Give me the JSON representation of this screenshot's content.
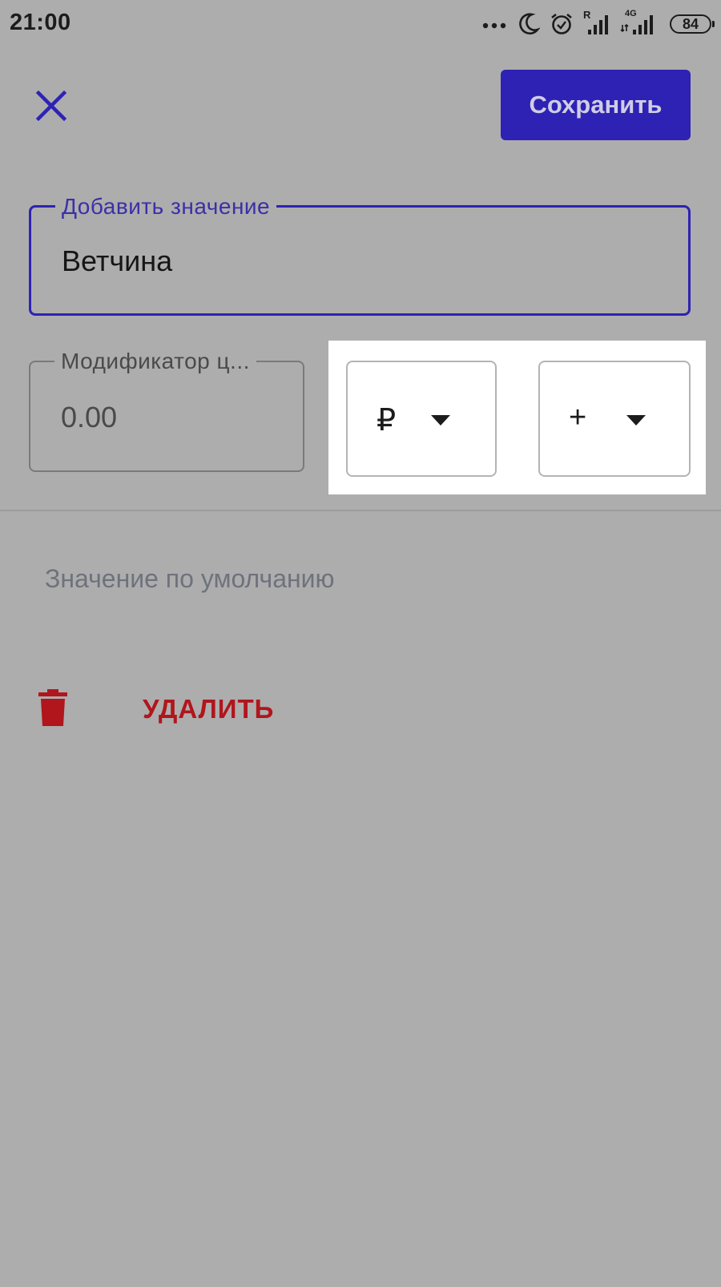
{
  "status_bar": {
    "time": "21:00",
    "battery": "84",
    "network_label": "4G",
    "roaming_label": "R"
  },
  "header": {
    "save_label": "Сохранить"
  },
  "form": {
    "name_field": {
      "label": "Добавить значение",
      "value": "Ветчина"
    },
    "modifier_field": {
      "label": "Модификатор ц...",
      "value": "0.00"
    },
    "currency_select": {
      "selected": "₽"
    },
    "sign_select": {
      "selected": "+"
    },
    "default_value_label": "Значение по умолчанию",
    "delete_label": "УДАЛИТЬ"
  },
  "colors": {
    "accent": "#2e22b4",
    "danger": "#b0161c",
    "overlay_background": "#adadad"
  }
}
